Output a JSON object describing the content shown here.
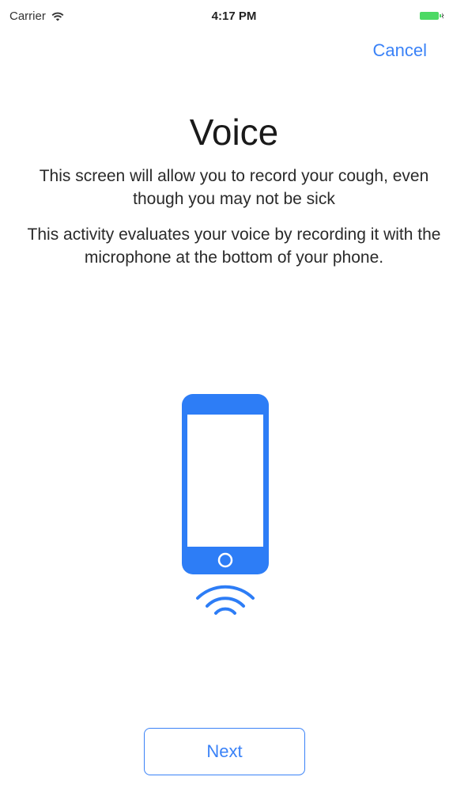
{
  "status_bar": {
    "carrier": "Carrier",
    "time": "4:17 PM",
    "battery_color": "#4cd964"
  },
  "nav": {
    "cancel_label": "Cancel"
  },
  "content": {
    "title": "Voice",
    "paragraphs": [
      "This screen will allow you to record your cough, even though you may not be sick",
      "This activity evaluates your voice by recording it with the microphone at the bottom of your phone."
    ],
    "illustration_icon": "phone-with-sound-waves-icon"
  },
  "footer": {
    "next_label": "Next"
  },
  "colors": {
    "accent": "#3a82f7"
  }
}
